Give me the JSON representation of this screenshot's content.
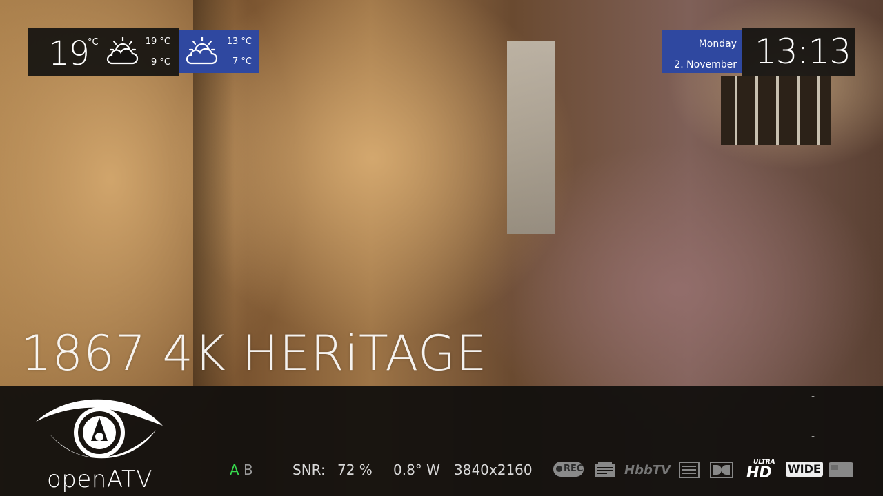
{
  "weather": {
    "current": {
      "temperature": "19",
      "unit": "°C",
      "icon": "partly-cloudy-icon",
      "high": "19 °C",
      "low": "9 °C"
    },
    "forecast": {
      "icon": "partly-cloudy-icon",
      "high": "13 °C",
      "low": "7 °C"
    }
  },
  "datetime": {
    "day": "Monday",
    "date": "2. November",
    "time": "13:13"
  },
  "channel": {
    "name": "1867 4K HERiTAGE"
  },
  "infobar": {
    "logo_text": "openATV",
    "event_now_time": "-",
    "event_next_time": "-",
    "tuner_active": "A",
    "tuner_inactive": "B",
    "snr_label": "SNR:",
    "snr_value": "72 %",
    "orbital_position": "0.8° W",
    "resolution": "3840x2160",
    "badges": {
      "rec": "REC",
      "hbbtv": "HbbTV",
      "ultra": "ULTRA",
      "hd": "HD",
      "wide": "WIDE"
    }
  },
  "colors": {
    "accent_blue": "#2f48a0",
    "panel_dark": "#141210",
    "tuner_active": "#37d94d"
  }
}
